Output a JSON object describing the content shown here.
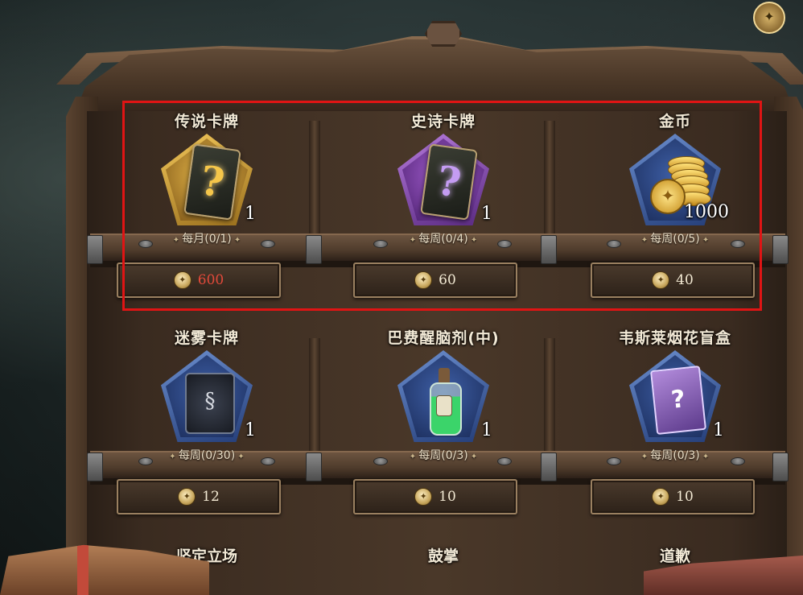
{
  "colors": {
    "highlight": "#e01414",
    "price_red": "#e2493a",
    "text": "#f2e9d6"
  },
  "top_right_icon": "crest-icon",
  "slots": [
    {
      "title": "传说卡牌",
      "count": "1",
      "limit": "每月(0/1)",
      "price": "600",
      "theme": "gold",
      "icon": "legendary-card-icon"
    },
    {
      "title": "史诗卡牌",
      "count": "1",
      "limit": "每周(0/4)",
      "price": "60",
      "theme": "purple",
      "icon": "epic-card-icon"
    },
    {
      "title": "金币",
      "count": "1000",
      "limit": "每周(0/5)",
      "price": "40",
      "theme": "blue",
      "icon": "gold-coins-icon"
    },
    {
      "title": "迷雾卡牌",
      "count": "1",
      "limit": "每周(0/30)",
      "price": "12",
      "theme": "blue",
      "icon": "mist-card-icon"
    },
    {
      "title": "巴费醒脑剂(中)",
      "count": "1",
      "limit": "每周(0/3)",
      "price": "10",
      "theme": "blue",
      "icon": "potion-icon"
    },
    {
      "title": "韦斯莱烟花盲盒",
      "count": "1",
      "limit": "每周(0/3)",
      "price": "10",
      "theme": "blue",
      "icon": "blind-box-icon"
    }
  ],
  "bottom_row": [
    {
      "title": "坚定立场"
    },
    {
      "title": "鼓掌"
    },
    {
      "title": "道歉"
    }
  ],
  "currency_icon": "crest-currency-icon"
}
